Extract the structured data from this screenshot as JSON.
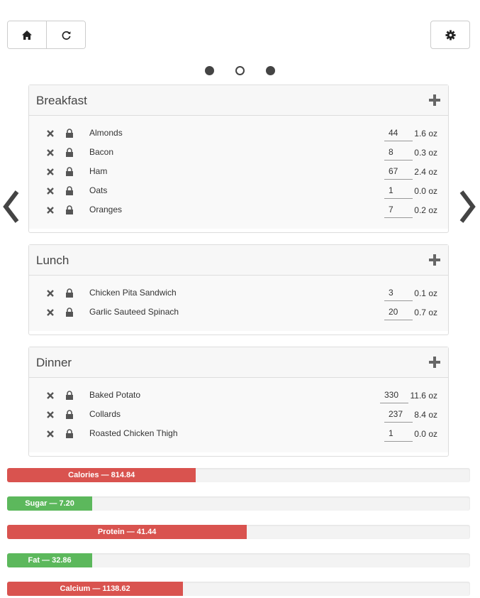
{
  "toolbar": {
    "home_icon": "home-icon",
    "refresh_icon": "refresh-icon",
    "settings_icon": "gear-icon"
  },
  "pager": {
    "dots": [
      "filled",
      "hollow",
      "filled"
    ],
    "active_index": 1
  },
  "meals": [
    {
      "title": "Breakfast",
      "items": [
        {
          "name": "Almonds",
          "qty": "44",
          "oz": "1.6 oz"
        },
        {
          "name": "Bacon",
          "qty": "8",
          "oz": "0.3 oz"
        },
        {
          "name": "Ham",
          "qty": "67",
          "oz": "2.4 oz"
        },
        {
          "name": "Oats",
          "qty": "1",
          "oz": "0.0 oz"
        },
        {
          "name": "Oranges",
          "qty": "7",
          "oz": "0.2 oz"
        }
      ]
    },
    {
      "title": "Lunch",
      "items": [
        {
          "name": "Chicken Pita Sandwich",
          "qty": "3",
          "oz": "0.1 oz"
        },
        {
          "name": "Garlic Sauteed Spinach",
          "qty": "20",
          "oz": "0.7 oz"
        }
      ]
    },
    {
      "title": "Dinner",
      "items": [
        {
          "name": "Baked Potato",
          "qty": "330",
          "oz": "11.6 oz"
        },
        {
          "name": "Collards",
          "qty": "237",
          "oz": "8.4 oz"
        },
        {
          "name": "Roasted Chicken Thigh",
          "qty": "1",
          "oz": "0.0 oz"
        }
      ]
    }
  ],
  "nutrients": [
    {
      "label": "Calories — 814.84",
      "fill": 0.408,
      "color": "#d9534f"
    },
    {
      "label": "Sugar — 7.20",
      "fill": 0.184,
      "color": "#5cb85c"
    },
    {
      "label": "Protein — 41.44",
      "fill": 0.518,
      "color": "#d9534f"
    },
    {
      "label": "Fat — 32.86",
      "fill": 0.184,
      "color": "#5cb85c"
    },
    {
      "label": "Calcium — 1138.62",
      "fill": 0.38,
      "color": "#d9534f"
    }
  ]
}
